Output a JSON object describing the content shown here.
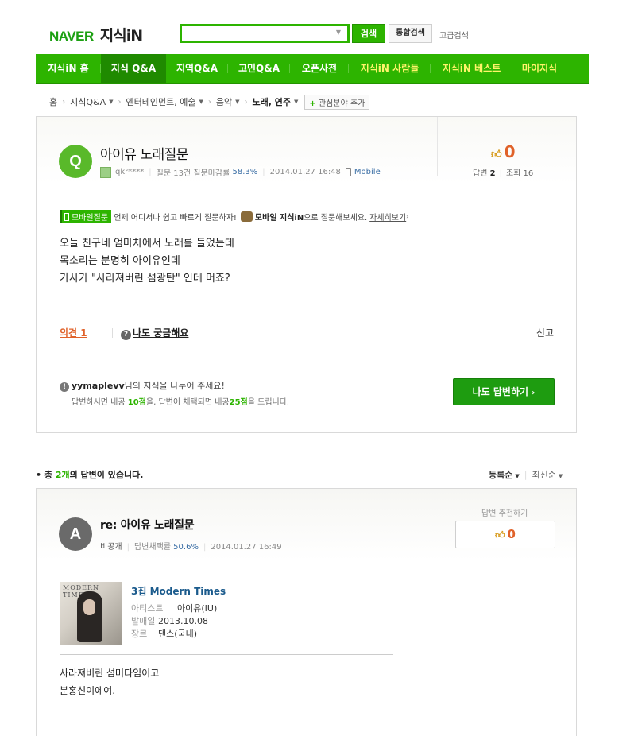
{
  "header": {
    "logo_naver": "NAVER",
    "logo_service": "지식iN",
    "search_value": "",
    "search_button": "검색",
    "total_search_button": "통합검색",
    "advanced_search_link": "고급검색"
  },
  "nav": {
    "items": [
      {
        "label": "지식iN 홈"
      },
      {
        "label": "지식 Q&A"
      },
      {
        "label": "지역Q&A"
      },
      {
        "label": "고민Q&A"
      },
      {
        "label": "오픈사전"
      },
      {
        "label": "지식iN 사람들"
      },
      {
        "label": "지식iN 베스트"
      },
      {
        "label": "마이지식"
      }
    ]
  },
  "breadcrumb": {
    "home": "홈",
    "c1": "지식Q&A",
    "c2": "엔터테인먼트, 예술",
    "c3": "음악",
    "current": "노래, 연주",
    "add_interest": "관심분야 추가"
  },
  "question": {
    "avatar_letter": "Q",
    "title": "아이유 노래질문",
    "user": "qkr****",
    "stats_text": "질문 13건 질문마감률",
    "close_rate": "58.3%",
    "datetime": "2014.01.27 16:48",
    "mobile_label": "Mobile",
    "likes": "0",
    "answers_label": "답변",
    "answers_count": "2",
    "views_label": "조회",
    "views_count": "16",
    "mobile_badge": "모바일질문",
    "mobile_text": "언제 어디서나 쉽고 빠르게 질문하자!",
    "mobile_bold": "모바일 지식iN",
    "mobile_text2": "으로 질문해보세요.",
    "mobile_link": "자세히보기",
    "body_line1": "오늘 친구네 엄마차에서 노래를 들었는데",
    "body_line2": "목소리는 분명히 아이유인데",
    "body_line3": "가사가 \"사라져버린 섬광탄\" 인데 머죠?",
    "opinion": "의견 1",
    "curious": "나도 궁금해요",
    "report": "신고",
    "share_user": "yymaplevv",
    "share_text": "님의 지식을 나누어 주세요!",
    "share2_a": "답변하시면 내공 ",
    "share2_pts1": "10점",
    "share2_b": "을, 답변이 채택되면 내공",
    "share2_pts2": "25점",
    "share2_c": "을 드립니다.",
    "answer_button": "나도 답변하기"
  },
  "answers_header": {
    "prefix": "총 ",
    "count": "2개",
    "suffix": "의 답변이 있습니다.",
    "sort_registered": "등록순",
    "sort_latest": "최신순"
  },
  "answer": {
    "avatar_letter": "A",
    "title": "re: 아이유 노래질문",
    "user": "비공개",
    "adopt_text": "답변채택률",
    "adopt_rate": "50.6%",
    "datetime": "2014.01.27 16:49",
    "recommend_label": "답변 추천하기",
    "recommend_count": "0",
    "album_art_text": "MODERN TIMES",
    "album_title": "3집 Modern Times",
    "artist_key": "아티스트",
    "artist_value": "아이유(IU)",
    "release_key": "발매일",
    "release_value": "2013.10.08",
    "genre_key": "장르",
    "genre_value": "댄스(국내)",
    "body_line1": "사라져버린 섬머타임이고",
    "body_line2": "분홍신이에여."
  }
}
